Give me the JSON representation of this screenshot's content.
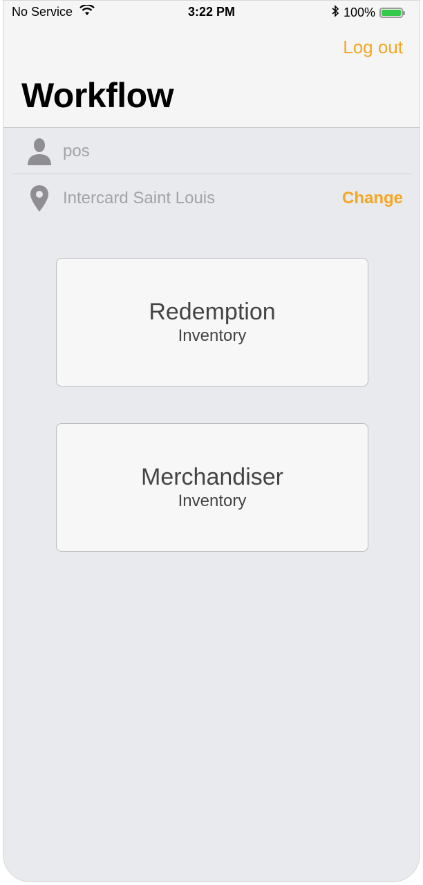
{
  "status_bar": {
    "carrier": "No Service",
    "time": "3:22 PM",
    "battery": "100%",
    "battery_level": 1.0,
    "icons": [
      "wifi-icon",
      "bluetooth-icon",
      "battery-icon"
    ]
  },
  "header": {
    "logout_label": "Log out",
    "title": "Workflow"
  },
  "user_row": {
    "username": "pos",
    "icon": "user-icon"
  },
  "location_row": {
    "location": "Intercard Saint Louis",
    "change_label": "Change",
    "icon": "location-pin-icon"
  },
  "cards": [
    {
      "title": "Redemption",
      "subtitle": "Inventory"
    },
    {
      "title": "Merchandiser",
      "subtitle": "Inventory"
    }
  ],
  "colors": {
    "accent": "#f5a623",
    "background": "#e9eaed",
    "battery": "#35c94a"
  }
}
